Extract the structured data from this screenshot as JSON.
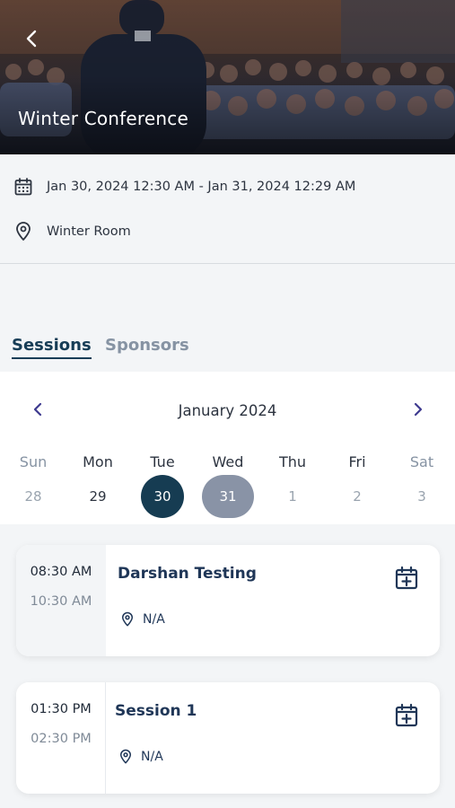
{
  "hero": {
    "title": "Winter Conference"
  },
  "event": {
    "date_range": "Jan 30, 2024 12:30 AM - Jan 31, 2024 12:29 AM",
    "location": "Winter Room"
  },
  "tabs": [
    {
      "label": "Sessions",
      "active": true
    },
    {
      "label": "Sponsors",
      "active": false
    }
  ],
  "calendar": {
    "month_label": "January 2024",
    "weekdays": [
      "Sun",
      "Mon",
      "Tue",
      "Wed",
      "Thu",
      "Fri",
      "Sat"
    ],
    "days": [
      "28",
      "29",
      "30",
      "31",
      "1",
      "2",
      "3"
    ],
    "selected_day": "30",
    "range_end_day": "31"
  },
  "sessions": [
    {
      "start": "08:30 AM",
      "end": "10:30 AM",
      "title": "Darshan Testing",
      "location": "N/A"
    },
    {
      "start": "01:30 PM",
      "end": "02:30 PM",
      "title": "Session 1",
      "location": "N/A"
    }
  ],
  "colors": {
    "primary": "#163c52",
    "range": "#8993a6",
    "nav_arrow": "#3e3a8f",
    "session_text": "#1f3657"
  },
  "icons": [
    "back-icon",
    "calendar-icon",
    "location-pin-icon",
    "chevron-left-icon",
    "chevron-right-icon",
    "calendar-add-icon"
  ]
}
